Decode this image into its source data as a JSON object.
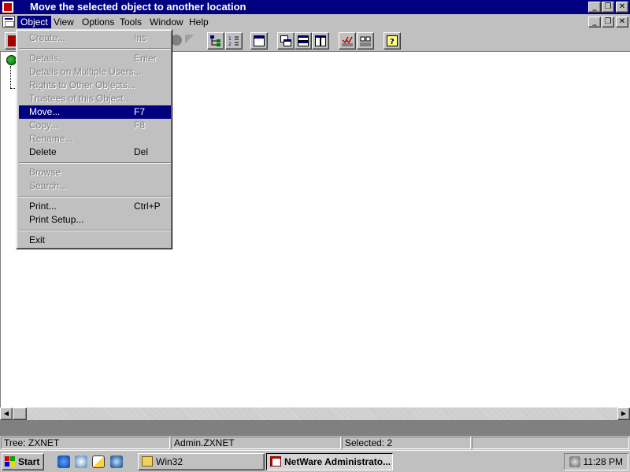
{
  "window": {
    "title": "Move the selected object to another location",
    "controls": {
      "minimize": "_",
      "restore": "❐",
      "close": "✕"
    }
  },
  "menubar": {
    "items": [
      "Object",
      "View",
      "Options",
      "Tools",
      "Window",
      "Help"
    ]
  },
  "object_menu": {
    "items": [
      {
        "label": "Create...",
        "shortcut": "Ins",
        "enabled": false
      },
      {
        "label": "Details...",
        "shortcut": "Enter",
        "enabled": false
      },
      {
        "label": "Details on Multiple Users...",
        "shortcut": "",
        "enabled": false
      },
      {
        "label": "Rights to Other Objects...",
        "shortcut": "",
        "enabled": false
      },
      {
        "label": "Trustees of this Object...",
        "shortcut": "",
        "enabled": false
      },
      {
        "label": "Move...",
        "shortcut": "F7",
        "enabled": true,
        "selected": true
      },
      {
        "label": "Copy...",
        "shortcut": "F8",
        "enabled": false
      },
      {
        "label": "Rename...",
        "shortcut": "",
        "enabled": false
      },
      {
        "label": "Delete",
        "shortcut": "Del",
        "enabled": true
      },
      {
        "label": "Browse",
        "shortcut": "",
        "enabled": false
      },
      {
        "label": "Search...",
        "shortcut": "",
        "enabled": false
      },
      {
        "label": "Print...",
        "shortcut": "Ctrl+P",
        "enabled": true
      },
      {
        "label": "Print Setup...",
        "shortcut": "",
        "enabled": true
      },
      {
        "label": "Exit",
        "shortcut": "",
        "enabled": true
      }
    ]
  },
  "statusbar": {
    "tree": "Tree: ZXNET",
    "context": "Admin.ZXNET",
    "selected": "Selected: 2"
  },
  "taskbar": {
    "start_label": "Start",
    "tasks": [
      {
        "label": "Win32",
        "pressed": false
      },
      {
        "label": "NetWare Administrato...",
        "pressed": true
      }
    ],
    "clock": "11:28 PM"
  },
  "colors": {
    "titlebar": "#000080",
    "menu_highlight": "#000080",
    "face": "#c0c0c0"
  }
}
